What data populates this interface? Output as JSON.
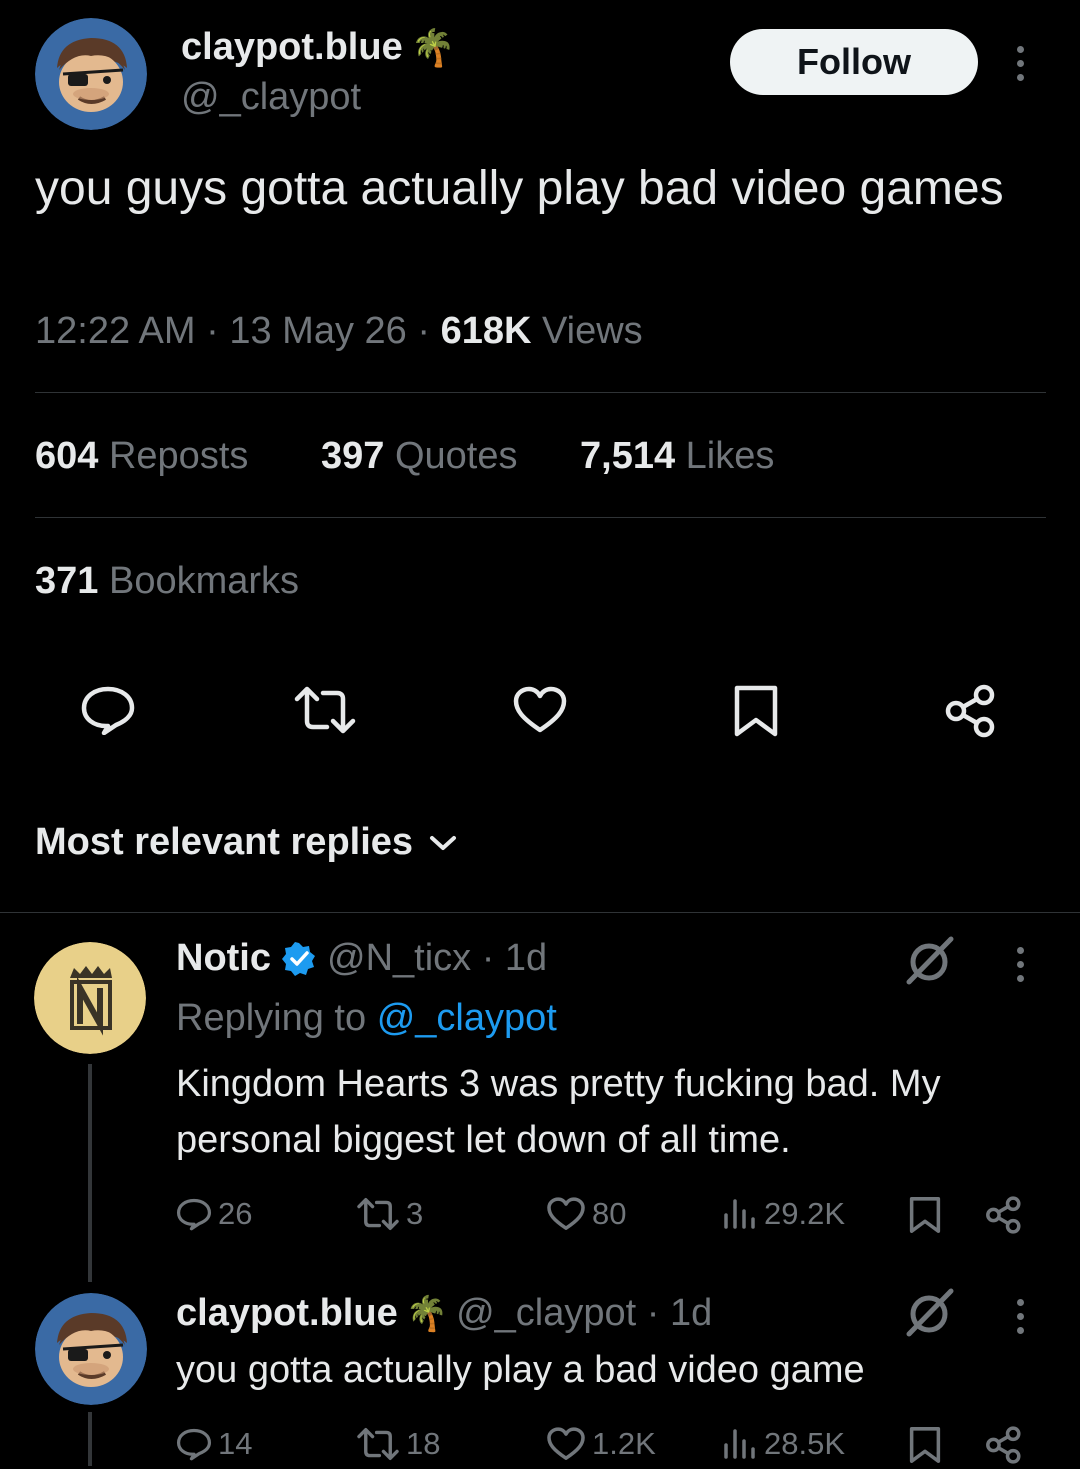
{
  "tweet": {
    "author_name": "claypot.blue",
    "author_badge_emoji": "🌴",
    "author_handle": "@_claypot",
    "follow_label": "Follow",
    "text": "you guys gotta actually play bad video games",
    "time": "12:22 AM",
    "date": "13 May 26",
    "views_count": "618K",
    "views_label": "Views",
    "reposts_count": "604",
    "reposts_label": "Reposts",
    "quotes_count": "397",
    "quotes_label": "Quotes",
    "likes_count": "7,514",
    "likes_label": "Likes",
    "bookmarks_count": "371",
    "bookmarks_label": "Bookmarks"
  },
  "replies_header": {
    "label": "Most relevant replies"
  },
  "replies": [
    {
      "name": "Notic",
      "handle_time": "@N_ticx · 1d",
      "replying_prefix": "Replying to",
      "replying_handle": "@_claypot",
      "text": "Kingdom Hearts 3 was pretty fucking bad. My personal biggest let down of all time.",
      "replies": "26",
      "reposts": "3",
      "likes": "80",
      "views": "29.2K"
    },
    {
      "name": "claypot.blue",
      "badge_emoji": "🌴",
      "handle_time": "@_claypot · 1d",
      "text": "you gotta actually play a bad video game",
      "replies": "14",
      "reposts": "18",
      "likes": "1.2K",
      "views": "28.5K"
    }
  ],
  "colors": {
    "background": "#000000",
    "text": "#e7e9ea",
    "muted": "#71767b",
    "link": "#1d9bf0",
    "verified": "#1d9bf0",
    "avatar_blue": "#3a6aa5",
    "avatar_gold": "#e8d089"
  }
}
